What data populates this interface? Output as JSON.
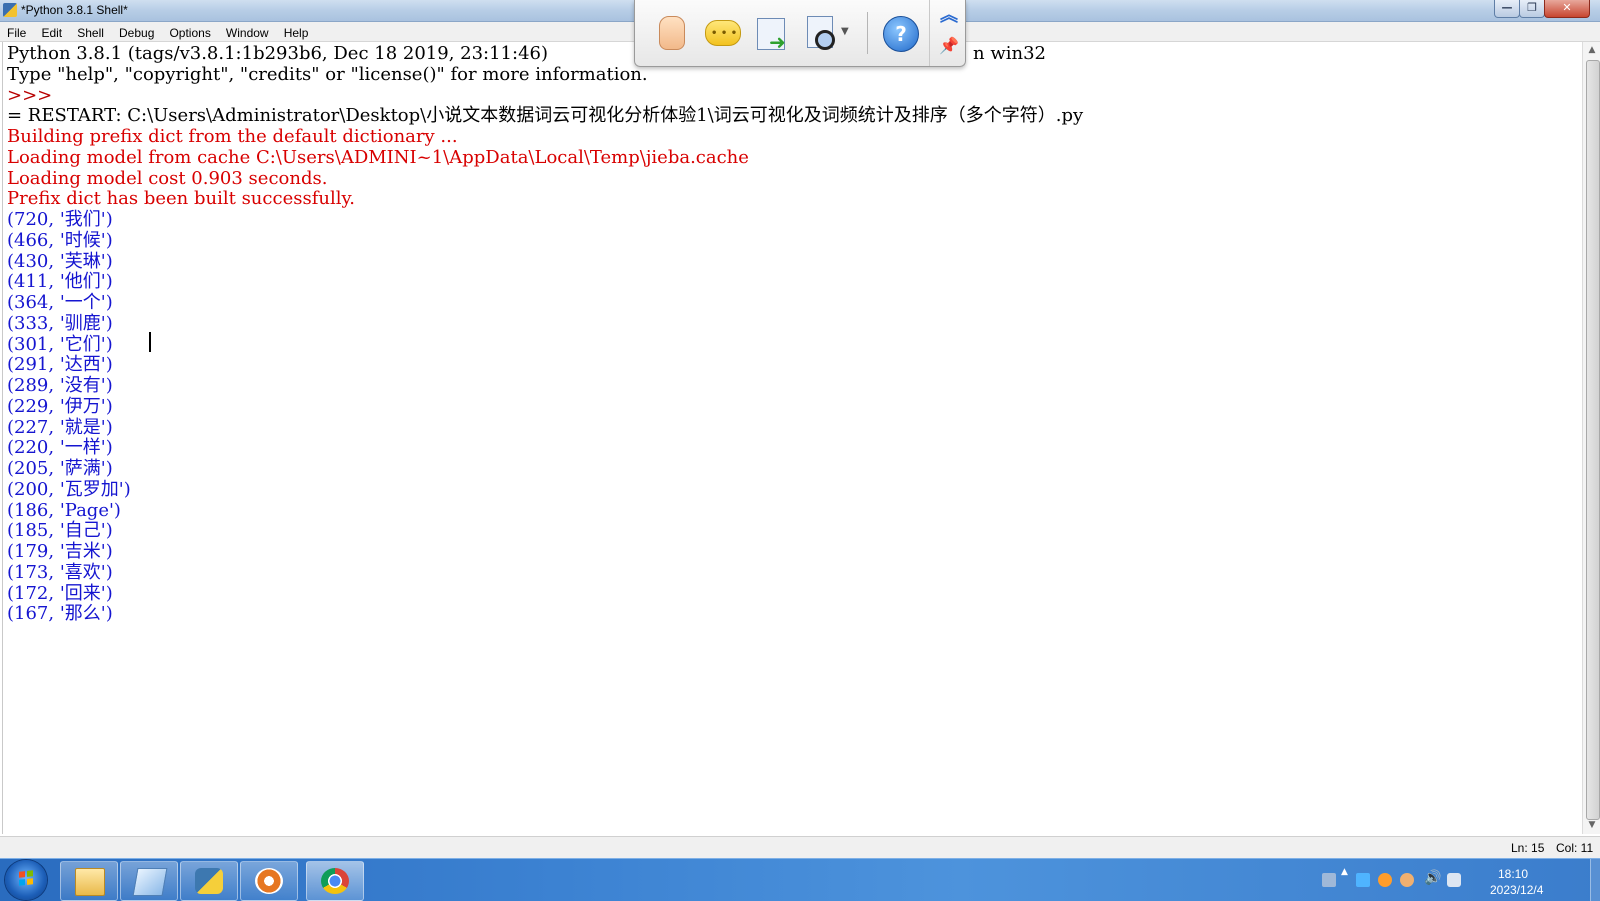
{
  "window": {
    "title": "*Python 3.8.1 Shell*",
    "min_glyph": "—",
    "max_glyph": "❐",
    "close_glyph": "✕"
  },
  "menu": {
    "items": [
      "File",
      "Edit",
      "Shell",
      "Debug",
      "Options",
      "Window",
      "Help"
    ]
  },
  "shell": {
    "lines": [
      {
        "text": "Python 3.8.1 (tags/v3.8.1:1b293b6, Dec 18 2019, 23:11:46)",
        "color": "black"
      },
      {
        "text": "Type \"help\", \"copyright\", \"credits\" or \"license()\" for more information.",
        "color": "black"
      },
      {
        "text": ">>>",
        "color": "prompt"
      },
      {
        "text": "= RESTART: C:\\Users\\Administrator\\Desktop\\小说文本数据词云可视化分析体验1\\词云可视化及词频统计及排序（多个字符）.py",
        "color": "black"
      },
      {
        "text": "Building prefix dict from the default dictionary ...",
        "color": "red"
      },
      {
        "text": "Loading model from cache C:\\Users\\ADMINI~1\\AppData\\Local\\Temp\\jieba.cache",
        "color": "red"
      },
      {
        "text": "Loading model cost 0.903 seconds.",
        "color": "red"
      },
      {
        "text": "Prefix dict has been built successfully.",
        "color": "red"
      },
      {
        "text": "(720, '我们')",
        "color": "blue"
      },
      {
        "text": "(466, '时候')",
        "color": "blue"
      },
      {
        "text": "(430, '芙琳')",
        "color": "blue"
      },
      {
        "text": "(411, '他们')",
        "color": "blue"
      },
      {
        "text": "(364, '一个')",
        "color": "blue"
      },
      {
        "text": "(333, '驯鹿')",
        "color": "blue"
      },
      {
        "text": "(301, '它们')",
        "color": "blue"
      },
      {
        "text": "(291, '达西')",
        "color": "blue"
      },
      {
        "text": "(289, '没有')",
        "color": "blue"
      },
      {
        "text": "(229, '伊万')",
        "color": "blue"
      },
      {
        "text": "(227, '就是')",
        "color": "blue"
      },
      {
        "text": "(220, '一样')",
        "color": "blue"
      },
      {
        "text": "(205, '萨满')",
        "color": "blue"
      },
      {
        "text": "(200, '瓦罗加')",
        "color": "blue"
      },
      {
        "text": "(186, 'Page')",
        "color": "blue"
      },
      {
        "text": "(185, '自己')",
        "color": "blue"
      },
      {
        "text": "(179, '吉米')",
        "color": "blue"
      },
      {
        "text": "(173, '喜欢')",
        "color": "blue"
      },
      {
        "text": "(172, '回来')",
        "color": "blue"
      },
      {
        "text": "(167, '那么')",
        "color": "blue"
      }
    ],
    "hidden_tail": "n win32"
  },
  "status": {
    "ln": "Ln: 15",
    "col": "Col: 11"
  },
  "taskbar": {
    "clock_time": "18:10",
    "clock_date": "2023/12/4",
    "apps": [
      "file-explorer",
      "notepad",
      "python-idle",
      "tool",
      "chrome"
    ]
  },
  "floating_toolbar": {
    "help_glyph": "?",
    "collapse_glyph": "︽",
    "pin_glyph": "📌",
    "comment_dots": "• • •"
  },
  "colors": {
    "output_red": "#d80000",
    "result_blue": "#1515d0",
    "prompt": "#b80000",
    "taskbar": "#3c82d2"
  }
}
